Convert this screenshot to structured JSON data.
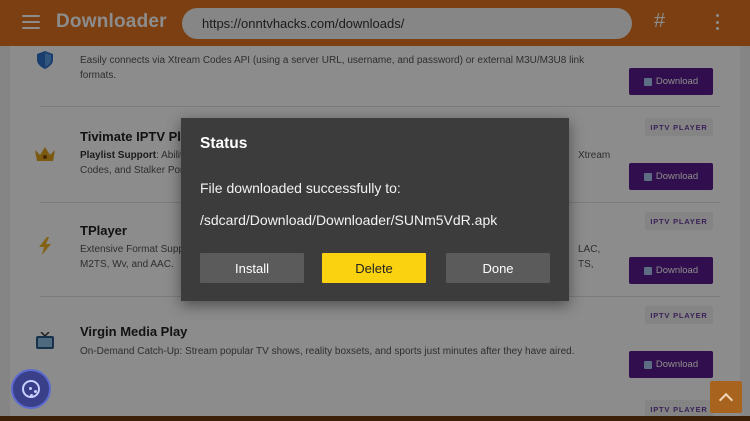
{
  "header": {
    "app_title": "Downloader",
    "url": "https://onntvhacks.com/downloads/",
    "hash_label": "#"
  },
  "items": [
    {
      "title": "",
      "desc_bold": "",
      "desc": "Easily connects via Xtream Codes API (using a server URL, username, and password) or external M3U/M3U8 link formats.",
      "icon": "shield-icon",
      "download_label": "Download"
    },
    {
      "title": "Tivimate IPTV Playe",
      "desc_bold": "Playlist Support",
      "desc": ": Ability",
      "desc_right": "Xtream",
      "desc_line2": "Codes, and Stalker Porta",
      "icon": "crown-icon",
      "tag": "IPTV PLAYER",
      "download_label": "Download"
    },
    {
      "title": "TPlayer",
      "desc": "Extensive Format Suppo",
      "desc_right": "LAC, TS,",
      "desc_line2": "M2TS, Wv, and AAC.",
      "icon": "lightning-icon",
      "tag": "IPTV PLAYER",
      "download_label": "Download"
    },
    {
      "title": "Virgin Media Play",
      "desc": "On-Demand Catch-Up: Stream popular TV shows, reality boxsets, and sports just minutes after they have aired.",
      "icon": "tv-icon",
      "tag": "IPTV PLAYER",
      "download_label": "Download"
    },
    {
      "tag": "IPTV PLAYER"
    }
  ],
  "dialog": {
    "title": "Status",
    "message": "File downloaded successfully to:",
    "path": "/sdcard/Download/Downloader/SUNm5VdR.apk",
    "install_label": "Install",
    "delete_label": "Delete",
    "done_label": "Done"
  },
  "colors": {
    "header": "#e0731f",
    "accent_button": "#fbd20f",
    "download_button": "#5a1a8c",
    "dialog_bg": "#3c3c3c"
  }
}
